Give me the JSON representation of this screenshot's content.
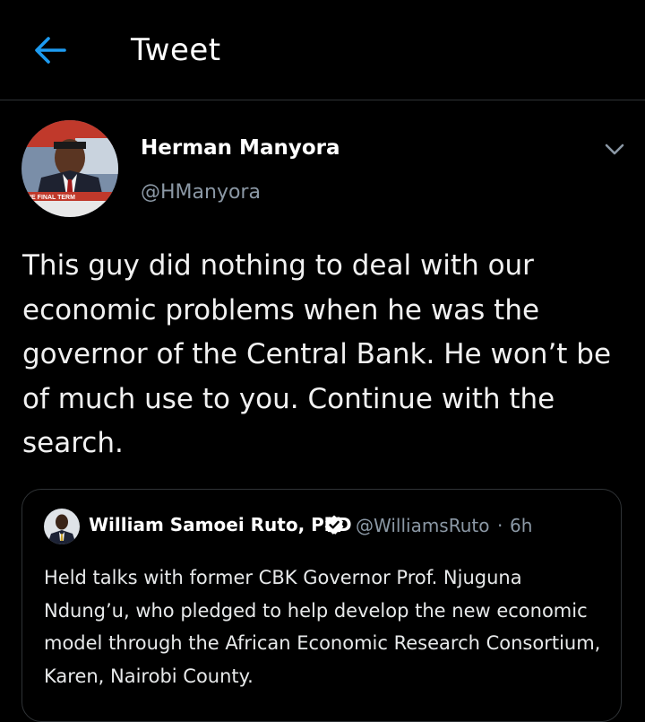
{
  "header": {
    "title": "Tweet",
    "back_icon": "arrow-left-icon",
    "accent_color": "#1d9bf0"
  },
  "tweet": {
    "author_name": "Herman Manyora",
    "author_handle": "@HManyora",
    "avatar_caption": "THE FINAL TERM",
    "menu_icon": "chevron-down-icon",
    "text": "This guy did nothing to deal with our economic problems when he was the governor of the Central Bank. He won’t be of much use to you. Continue with the search."
  },
  "quoted_tweet": {
    "author_name": "William Samoei Ruto, PhD",
    "verified_icon": "verified-badge-icon",
    "author_handle": "@WilliamsRuto",
    "separator": "·",
    "time": "6h",
    "text": "Held talks with former CBK Governor Prof. Njuguna Ndung’u, who pledged to help develop the new economic model through the African Economic Research Consortium, Karen, Nairobi County."
  }
}
